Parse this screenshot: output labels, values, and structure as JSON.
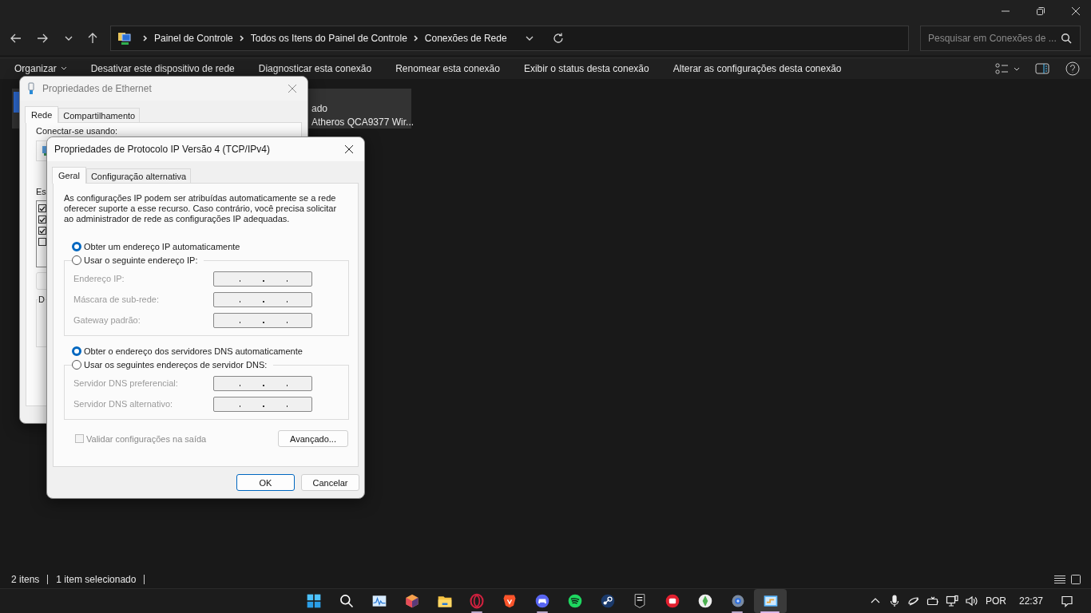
{
  "explorer": {
    "breadcrumbs": [
      "Painel de Controle",
      "Todos os Itens do Painel de Controle",
      "Conexões de Rede"
    ],
    "search": {
      "placeholder": "Pesquisar em Conexões de ..."
    },
    "commands": [
      {
        "label": "Organizar",
        "kind": "menu"
      },
      {
        "label": "Desativar este dispositivo de rede",
        "kind": "action"
      },
      {
        "label": "Diagnosticar esta conexão",
        "kind": "action"
      },
      {
        "label": "Renomear esta conexão",
        "kind": "action"
      },
      {
        "label": "Exibir o status desta conexão",
        "kind": "action"
      },
      {
        "label": "Alterar as configurações desta conexão",
        "kind": "action"
      }
    ],
    "files": [
      {
        "selected": true,
        "lines": [
          "ado",
          "Atheros QCA9377 Wir..."
        ]
      }
    ],
    "status_bar": [
      "2 itens",
      "1 item selecionado"
    ]
  },
  "ethernet_dialog": {
    "title": "Propriedades de Ethernet",
    "tabs": [
      {
        "label": "Rede",
        "selected": true
      },
      {
        "label": "Compartilhamento",
        "selected": false
      }
    ],
    "connect_label": "Conectar-se usando:",
    "items_label": "Es",
    "components": [
      {
        "checked": true
      },
      {
        "checked": true
      },
      {
        "checked": true
      },
      {
        "checked": false
      }
    ],
    "description_label": "D"
  },
  "ipv4_dialog": {
    "title": "Propriedades de Protocolo IP Versão 4 (TCP/IPv4)",
    "tabs": [
      {
        "label": "Geral",
        "selected": true
      },
      {
        "label": "Configuração alternativa",
        "selected": false
      }
    ],
    "intro": "As configurações IP podem ser atribuídas automaticamente se a rede oferecer suporte a esse recurso. Caso contrário, você precisa solicitar ao administrador de rede as configurações IP adequadas.",
    "sections": [
      {
        "auto_label": "Obter um endereço IP automaticamente",
        "auto_selected": true,
        "manual_label": "Usar o seguinte endereço IP:",
        "manual_selected": false,
        "fields": [
          {
            "label": "Endereço IP:",
            "disabled": true
          },
          {
            "label": "Máscara de sub-rede:",
            "disabled": true
          },
          {
            "label": "Gateway padrão:",
            "disabled": true
          }
        ]
      },
      {
        "auto_label": "Obter o endereço dos servidores DNS automaticamente",
        "auto_selected": true,
        "manual_label": "Usar os seguintes endereços de servidor DNS:",
        "manual_selected": false,
        "fields": [
          {
            "label": "Servidor DNS preferencial:",
            "disabled": true
          },
          {
            "label": "Servidor DNS alternativo:",
            "disabled": true
          }
        ]
      }
    ],
    "validate": {
      "label": "Validar configurações na saída",
      "checked": false,
      "disabled": true
    },
    "advanced_button": "Avançado...",
    "buttons": [
      {
        "label": "OK",
        "default": true
      },
      {
        "label": "Cancelar",
        "default": false
      }
    ]
  },
  "taskbar": {
    "apps": [
      {
        "running": false,
        "active": false
      },
      {
        "running": false,
        "active": false
      },
      {
        "running": false,
        "active": false
      },
      {
        "running": false,
        "active": false
      },
      {
        "running": false,
        "active": false
      },
      {
        "running": true,
        "active": false
      },
      {
        "running": false,
        "active": false
      },
      {
        "running": true,
        "active": false
      },
      {
        "running": false,
        "active": false
      },
      {
        "running": false,
        "active": false
      },
      {
        "running": false,
        "active": false
      },
      {
        "running": false,
        "active": false
      },
      {
        "running": false,
        "active": false
      },
      {
        "running": true,
        "active": false
      },
      {
        "running": true,
        "active": true
      }
    ],
    "language": "POR",
    "time": "22:37"
  }
}
